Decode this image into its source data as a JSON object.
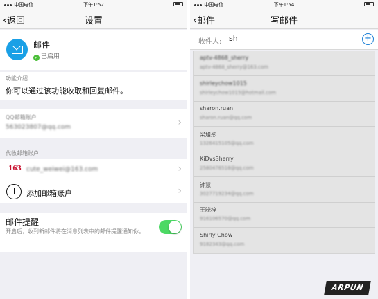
{
  "left": {
    "status": {
      "carrier": "中国电信",
      "time": "下午1:52"
    },
    "nav": {
      "back": "返回",
      "title": "设置"
    },
    "mail": {
      "name": "邮件",
      "status": "已启用"
    },
    "intro": {
      "label": "功能介绍",
      "text": "你可以通过该功能收取和回复邮件。"
    },
    "qq": {
      "label": "QQ邮箱账户",
      "value": "563023807@qq.com"
    },
    "agent": {
      "section": "代收邮箱账户",
      "logo": "163",
      "account": "cute_weiwei@163.com",
      "add_label": "添加邮箱账户"
    },
    "notify": {
      "title": "邮件提醒",
      "desc": "开启后，收到新邮件将在消息列表中的邮件提醒通知你。",
      "enabled": true
    }
  },
  "right": {
    "status": {
      "carrier": "中国电信",
      "time": "下午1:54"
    },
    "nav": {
      "back": "邮件",
      "title": "写邮件"
    },
    "recipient": {
      "label": "收件人:",
      "value": "sh",
      "add_icon": "+"
    },
    "suggestions": [
      {
        "name": "aptv-4868_sherry",
        "email": "aptv-4868_sherry@163.com"
      },
      {
        "name": "shirleychow1015",
        "email": "shirleychow1015@hotmail.com"
      },
      {
        "name": "sharon.ruan",
        "email": "sharon.ruan@qq.com"
      },
      {
        "name": "梁旭彤",
        "email": "1326415105@qq.com"
      },
      {
        "name": "KiDvsSherry",
        "email": "2580476518@qq.com"
      },
      {
        "name": "钟慧",
        "email": "3027719234@qq.com"
      },
      {
        "name": "王晓梓",
        "email": "916106570@qq.com"
      },
      {
        "name": "Shirly Chow",
        "email": "9182343@qq.com"
      }
    ]
  },
  "watermark": "ARPUN",
  "colors": {
    "accent": "#1a7fd6",
    "toggle_on": "#4cd964",
    "mail_icon": "#1aa0e6",
    "logo163": "#c8102e"
  }
}
